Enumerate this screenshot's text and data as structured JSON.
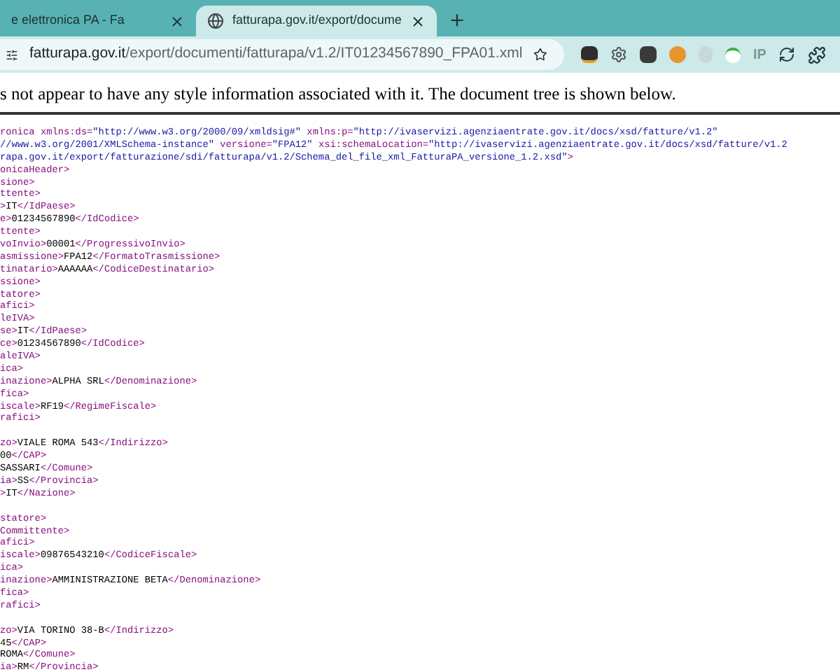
{
  "tabs": [
    {
      "title": "e elettronica PA - Fa",
      "selected": false
    },
    {
      "title": "fatturapa.gov.it/export/docume",
      "selected": true
    }
  ],
  "address_bar": {
    "host": "fatturapa.gov.it",
    "path": "/export/documenti/fatturapa/v1.2/IT01234567890_FPA01.xml"
  },
  "extension_label": "IP",
  "notice": "s not appear to have any style information associated with it. The document tree is shown below.",
  "xml_blocks": [
    [
      [
        {
          "kind": "tag",
          "text": "ronica xmlns:ds="
        },
        {
          "kind": "value",
          "text": "\"http://www.w3.org/2000/09/xmldsig#\""
        },
        {
          "kind": "tag",
          "text": " xmlns:p="
        },
        {
          "kind": "value",
          "text": "\"http://ivaservizi.agenziaentrate.gov.it/docs/xsd/fatture/v1.2\""
        }
      ],
      [
        {
          "kind": "value",
          "text": "//www.w3.org/2001/XMLSchema-instance\""
        },
        {
          "kind": "tag",
          "text": " versione="
        },
        {
          "kind": "value",
          "text": "\"FPA12\""
        },
        {
          "kind": "tag",
          "text": " xsi:schemaLocation="
        },
        {
          "kind": "value",
          "text": "\"http://ivaservizi.agenziaentrate.gov.it/docs/xsd/fatture/v1.2"
        }
      ],
      [
        {
          "kind": "value",
          "text": "rapa.gov.it/export/fatturazione/sdi/fatturapa/v1.2/Schema_del_file_xml_FatturaPA_versione_1.2.xsd\""
        },
        {
          "kind": "tag",
          "text": ">"
        }
      ],
      [
        {
          "kind": "tag",
          "text": "onicaHeader>"
        }
      ],
      [
        {
          "kind": "tag",
          "text": "sione>"
        }
      ],
      [
        {
          "kind": "tag",
          "text": "ttente>"
        }
      ],
      [
        {
          "kind": "tag",
          "text": ">"
        },
        {
          "kind": "text",
          "text": "IT"
        },
        {
          "kind": "tag",
          "text": "</IdPaese>"
        }
      ],
      [
        {
          "kind": "tag",
          "text": "e>"
        },
        {
          "kind": "text",
          "text": "01234567890"
        },
        {
          "kind": "tag",
          "text": "</IdCodice>"
        }
      ],
      [
        {
          "kind": "tag",
          "text": "ttente>"
        }
      ],
      [
        {
          "kind": "tag",
          "text": "voInvio>"
        },
        {
          "kind": "text",
          "text": "00001"
        },
        {
          "kind": "tag",
          "text": "</ProgressivoInvio>"
        }
      ],
      [
        {
          "kind": "tag",
          "text": "asmissione>"
        },
        {
          "kind": "text",
          "text": "FPA12"
        },
        {
          "kind": "tag",
          "text": "</FormatoTrasmissione>"
        }
      ],
      [
        {
          "kind": "tag",
          "text": "tinatario>"
        },
        {
          "kind": "text",
          "text": "AAAAAA"
        },
        {
          "kind": "tag",
          "text": "</CodiceDestinatario>"
        }
      ],
      [
        {
          "kind": "tag",
          "text": "ssione>"
        }
      ],
      [
        {
          "kind": "tag",
          "text": "tatore>"
        }
      ],
      [
        {
          "kind": "tag",
          "text": "afici>"
        }
      ],
      [
        {
          "kind": "tag",
          "text": "leIVA>"
        }
      ],
      [
        {
          "kind": "tag",
          "text": "se>"
        },
        {
          "kind": "text",
          "text": "IT"
        },
        {
          "kind": "tag",
          "text": "</IdPaese>"
        }
      ],
      [
        {
          "kind": "tag",
          "text": "ce>"
        },
        {
          "kind": "text",
          "text": "01234567890"
        },
        {
          "kind": "tag",
          "text": "</IdCodice>"
        }
      ],
      [
        {
          "kind": "tag",
          "text": "aleIVA>"
        }
      ],
      [
        {
          "kind": "tag",
          "text": "ica>"
        }
      ],
      [
        {
          "kind": "tag",
          "text": "inazione>"
        },
        {
          "kind": "text",
          "text": "ALPHA SRL"
        },
        {
          "kind": "tag",
          "text": "</Denominazione>"
        }
      ],
      [
        {
          "kind": "tag",
          "text": "fica>"
        }
      ],
      [
        {
          "kind": "tag",
          "text": "iscale>"
        },
        {
          "kind": "text",
          "text": "RF19"
        },
        {
          "kind": "tag",
          "text": "</RegimeFiscale>"
        }
      ],
      [
        {
          "kind": "tag",
          "text": "rafici>"
        }
      ]
    ],
    [
      [
        {
          "kind": "tag",
          "text": "zo>"
        },
        {
          "kind": "text",
          "text": "VIALE ROMA 543"
        },
        {
          "kind": "tag",
          "text": "</Indirizzo>"
        }
      ],
      [
        {
          "kind": "text",
          "text": "00"
        },
        {
          "kind": "tag",
          "text": "</CAP>"
        }
      ],
      [
        {
          "kind": "text",
          "text": "SASSARI"
        },
        {
          "kind": "tag",
          "text": "</Comune>"
        }
      ],
      [
        {
          "kind": "tag",
          "text": "ia>"
        },
        {
          "kind": "text",
          "text": "SS"
        },
        {
          "kind": "tag",
          "text": "</Provincia>"
        }
      ],
      [
        {
          "kind": "tag",
          "text": ">"
        },
        {
          "kind": "text",
          "text": "IT"
        },
        {
          "kind": "tag",
          "text": "</Nazione>"
        }
      ]
    ],
    [
      [
        {
          "kind": "tag",
          "text": "statore>"
        }
      ],
      [
        {
          "kind": "tag",
          "text": "Committente>"
        }
      ],
      [
        {
          "kind": "tag",
          "text": "afici>"
        }
      ],
      [
        {
          "kind": "tag",
          "text": "iscale>"
        },
        {
          "kind": "text",
          "text": "09876543210"
        },
        {
          "kind": "tag",
          "text": "</CodiceFiscale>"
        }
      ],
      [
        {
          "kind": "tag",
          "text": "ica>"
        }
      ],
      [
        {
          "kind": "tag",
          "text": "inazione>"
        },
        {
          "kind": "text",
          "text": "AMMINISTRAZIONE BETA"
        },
        {
          "kind": "tag",
          "text": "</Denominazione>"
        }
      ],
      [
        {
          "kind": "tag",
          "text": "fica>"
        }
      ],
      [
        {
          "kind": "tag",
          "text": "rafici>"
        }
      ]
    ],
    [
      [
        {
          "kind": "tag",
          "text": "zo>"
        },
        {
          "kind": "text",
          "text": "VIA TORINO 38-B"
        },
        {
          "kind": "tag",
          "text": "</Indirizzo>"
        }
      ],
      [
        {
          "kind": "text",
          "text": "45"
        },
        {
          "kind": "tag",
          "text": "</CAP>"
        }
      ],
      [
        {
          "kind": "text",
          "text": "ROMA"
        },
        {
          "kind": "tag",
          "text": "</Comune>"
        }
      ],
      [
        {
          "kind": "tag",
          "text": "ia>"
        },
        {
          "kind": "text",
          "text": "RM"
        },
        {
          "kind": "tag",
          "text": "</Provincia>"
        }
      ]
    ]
  ]
}
